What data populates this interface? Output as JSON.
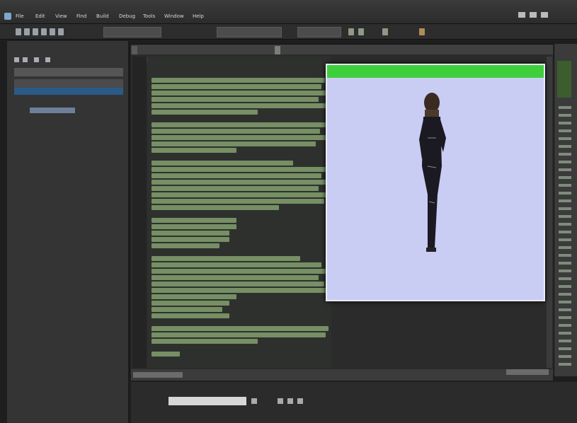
{
  "window": {
    "title": "",
    "icon": "app-icon"
  },
  "menubar": {
    "items": [
      {
        "label": "File"
      },
      {
        "label": "Edit"
      },
      {
        "label": "View"
      },
      {
        "label": "Find"
      },
      {
        "label": "Build"
      },
      {
        "label": "Debug"
      },
      {
        "label": "Tools"
      },
      {
        "label": "Window"
      },
      {
        "label": "Help"
      }
    ]
  },
  "toolbar": {
    "search_placeholder": ""
  },
  "left_panel": {
    "title": "",
    "tree": [
      {
        "label": ""
      },
      {
        "label": ""
      },
      {
        "label": ""
      },
      {
        "label": ""
      },
      {
        "label": ""
      }
    ]
  },
  "editor": {
    "tabs": [
      {
        "label": ""
      },
      {
        "label": ""
      }
    ]
  },
  "preview": {
    "title": "",
    "subtitle": "",
    "figure_icon": "person-figure-icon",
    "titlebar_color": "#3fcf3b",
    "background_color": "#c9cdf4"
  },
  "bottom": {
    "console_label": "",
    "console_value": ""
  },
  "colors": {
    "code_text": "#7e9a6a",
    "editor_bg": "#2e302e",
    "accent": "#3fcf3b"
  }
}
